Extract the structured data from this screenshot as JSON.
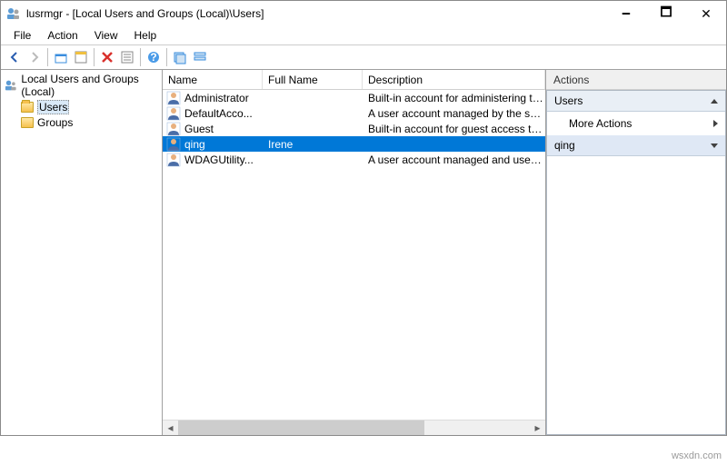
{
  "title": "lusrmgr - [Local Users and Groups (Local)\\Users]",
  "menu": {
    "file": "File",
    "action": "Action",
    "view": "View",
    "help": "Help"
  },
  "tree": {
    "root": "Local Users and Groups (Local)",
    "users": "Users",
    "groups": "Groups"
  },
  "list": {
    "headers": {
      "name": "Name",
      "fullname": "Full Name",
      "description": "Description"
    },
    "rows": [
      {
        "name": "Administrator",
        "fullname": "",
        "description": "Built-in account for administering the computer/domain"
      },
      {
        "name": "DefaultAcco...",
        "fullname": "",
        "description": "A user account managed by the system."
      },
      {
        "name": "Guest",
        "fullname": "",
        "description": "Built-in account for guest access to the computer/domain"
      },
      {
        "name": "qing",
        "fullname": "Irene",
        "description": ""
      },
      {
        "name": "WDAGUtility...",
        "fullname": "",
        "description": "A user account managed and used by the system for Windows Defender Application Guard scenarios."
      }
    ],
    "selected_index": 3
  },
  "actions": {
    "title": "Actions",
    "section_users": "Users",
    "more_actions": "More Actions",
    "section_selected": "qing"
  },
  "watermark": "wsxdn.com"
}
